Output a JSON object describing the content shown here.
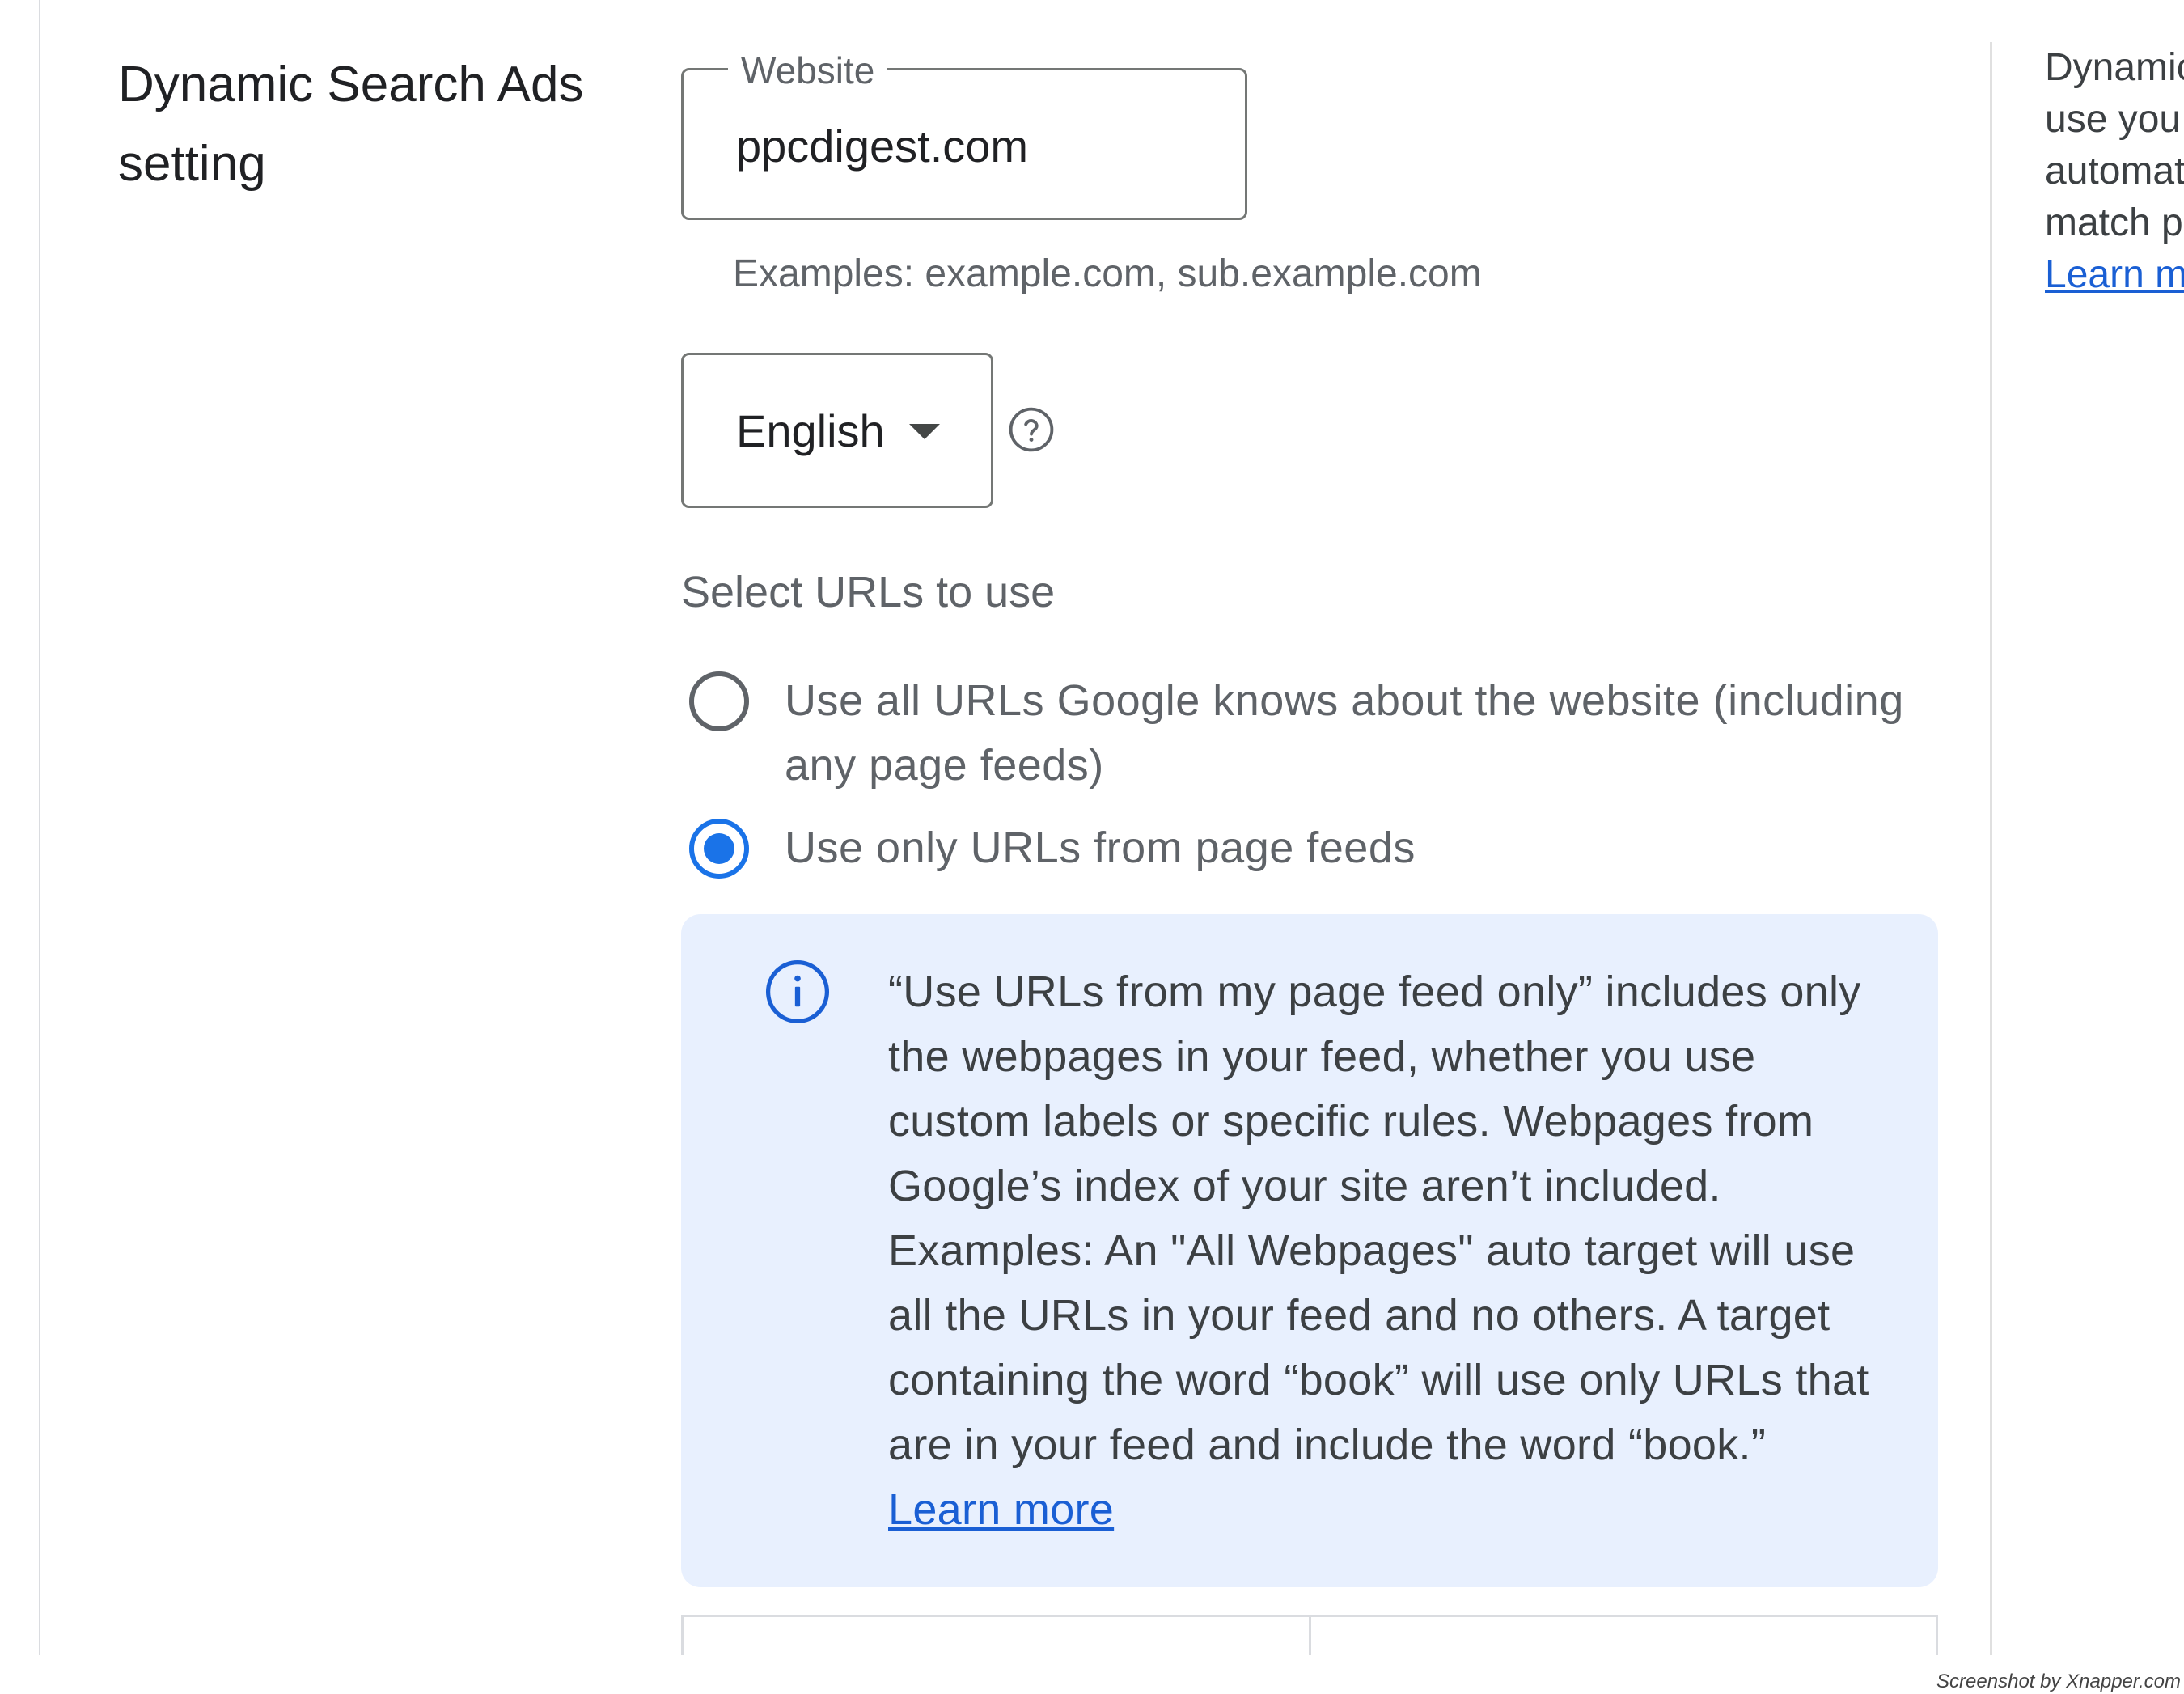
{
  "section": {
    "title_line1": "Dynamic Search Ads",
    "title_line2": "setting"
  },
  "website": {
    "label": "Website",
    "value": "ppcdigest.com",
    "hint": "Examples: example.com, sub.example.com"
  },
  "language": {
    "selected": "English",
    "help_icon": "help-circle-icon"
  },
  "urls": {
    "heading": "Select URLs to use",
    "options": [
      {
        "label": "Use all URLs Google knows about the website (including any page feeds)",
        "selected": false
      },
      {
        "label": "Use only URLs from page feeds",
        "selected": true
      }
    ]
  },
  "info": {
    "icon": "info-icon",
    "text": "“Use URLs from my page feed only” includes only the webpages in your feed, whether you use custom labels or specific rules. Webpages from Google’s index of your site aren’t included. Examples: An \"All Webpages\" auto target will use all the URLs in your feed and no others. A target containing the word “book” will use only URLs that are in your feed and include the word “book.”",
    "link": "Learn more"
  },
  "sidebar": {
    "lines": [
      "Dynamic",
      "use you",
      "automat",
      "match p"
    ],
    "link": "Learn m"
  },
  "watermark": "Screenshot by Xnapper.com",
  "colors": {
    "accent": "#1a73e8",
    "info_bg": "#e8f0fe",
    "link": "#1a5fd4"
  }
}
